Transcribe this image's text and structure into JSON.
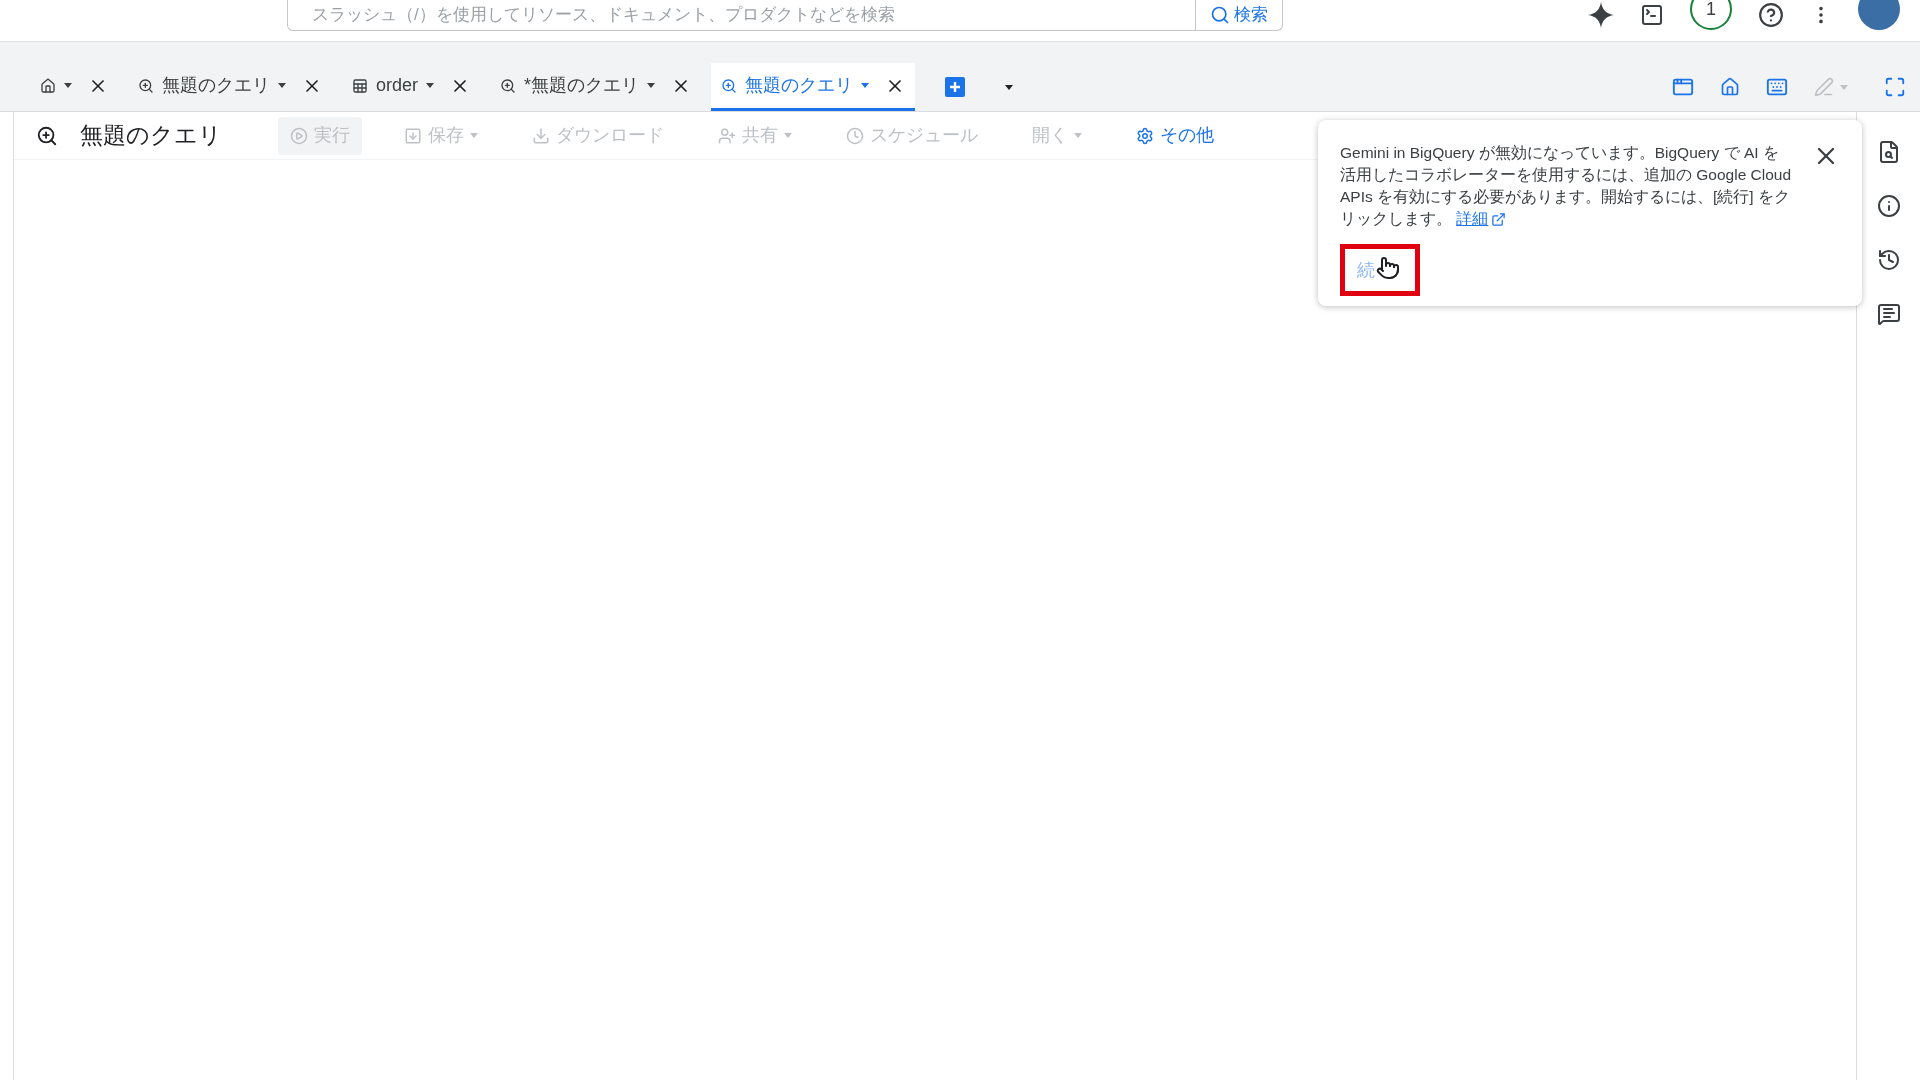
{
  "top_bar": {
    "search": {
      "placeholder": "スラッシュ（/）を使用してリソース、ドキュメント、プロダクトなどを検索"
    },
    "search_button": "検索",
    "notification_count": "1"
  },
  "tabs": [
    {
      "kind": "home",
      "selected": false
    },
    {
      "kind": "query",
      "label": "無題のクエリ",
      "selected": false
    },
    {
      "kind": "table",
      "label": "order",
      "selected": false
    },
    {
      "kind": "query",
      "label": "*無題のクエリ",
      "selected": false
    },
    {
      "kind": "query",
      "label": "無題のクエリ",
      "selected": true
    }
  ],
  "toolbar": {
    "title": "無題のクエリ",
    "buttons": [
      {
        "kind": "run",
        "label": "実行",
        "dropdown": false,
        "disabled": true
      },
      {
        "kind": "save",
        "label": "保存",
        "dropdown": true,
        "disabled": true
      },
      {
        "kind": "download",
        "label": "ダウンロード",
        "dropdown": false,
        "disabled": true
      },
      {
        "kind": "share",
        "label": "共有",
        "dropdown": true,
        "disabled": true
      },
      {
        "kind": "schedule",
        "label": "スケジュール",
        "dropdown": false,
        "disabled": true
      },
      {
        "kind": "open",
        "label": "開く",
        "dropdown": true,
        "disabled": true
      },
      {
        "kind": "more",
        "label": "その他",
        "dropdown": false,
        "disabled": false
      }
    ]
  },
  "popup": {
    "message": "Gemini in BigQuery が無効になっています。BigQuery で AI を活用したコラボレーターを使用するには、追加の Google Cloud APIs を有効にする必要があります。開始するには、[続行] をクリックします。",
    "link": "詳細",
    "continue_button": {
      "label": "続",
      "highlighted": true
    }
  }
}
